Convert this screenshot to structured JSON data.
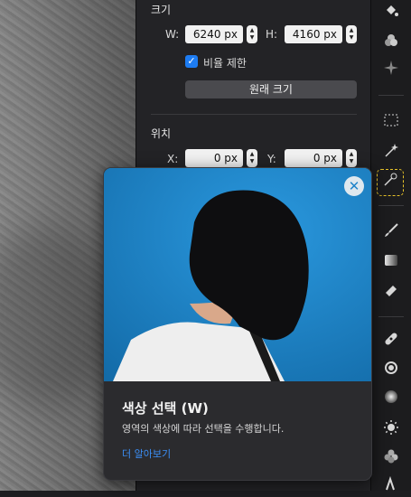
{
  "size": {
    "title": "크기",
    "w_label": "W:",
    "w_value": "6240 px",
    "h_label": "H:",
    "h_value": "4160 px",
    "constrain_label": "비율 제한",
    "constrain_checked": true,
    "original_button": "원래 크기"
  },
  "position": {
    "title": "위치",
    "x_label": "X:",
    "x_value": "0 px",
    "y_label": "Y:",
    "y_value": "0 px"
  },
  "popover": {
    "title": "색상 선택 (W)",
    "description": "영역의 색상에 따라 선택을 수행합니다.",
    "link": "더 알아보기",
    "close_icon": "close-icon"
  },
  "tools": [
    "paint-bucket-icon",
    "color-adjust-icon",
    "sparkle-icon",
    "rect-select-icon",
    "magic-wand-icon",
    "color-select-icon",
    "brush-icon",
    "gradient-icon",
    "eraser-icon",
    "bandage-icon",
    "clone-icon",
    "blur-icon",
    "sun-icon",
    "flower-icon",
    "pen-icon"
  ],
  "colors": {
    "accent": "#1d7cf2",
    "active_tool_border": "#e6c229",
    "hero_bg": "#1f84c9",
    "link": "#3b8ff7"
  }
}
